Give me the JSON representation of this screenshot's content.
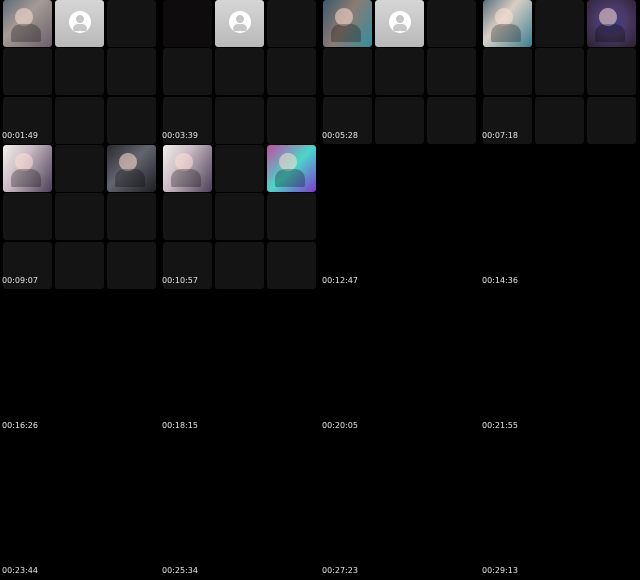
{
  "timestamps": [
    "00:01:49",
    "00:03:39",
    "00:05:28",
    "00:07:18",
    "00:09:07",
    "00:10:57",
    "00:12:47",
    "00:14:36",
    "00:16:26",
    "00:18:15",
    "00:20:05",
    "00:21:55",
    "00:23:44",
    "00:25:34",
    "00:27:23",
    "00:29:13"
  ],
  "tile_icons": {
    "avatar": "default-avatar-icon",
    "photo": "participant-photo-icon"
  },
  "colors": {
    "background": "#000000",
    "tile_empty": "#141414",
    "avatar_bg": "#c8c8c8",
    "timestamp_text": "#e6e6e6"
  }
}
